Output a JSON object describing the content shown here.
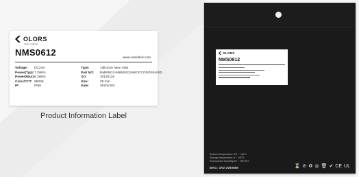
{
  "label": {
    "logo_text": "OLORS",
    "logo_tagline": "Colour Lighting",
    "model": "NMS0612",
    "website": "www.colorsled.com",
    "left_specs": [
      {
        "key": "Voltage:",
        "value": "DC24V"
      },
      {
        "key": "Power(Typ):",
        "value": "7.2W/m"
      },
      {
        "key": "Power(Max):",
        "value": "6.3W/m"
      },
      {
        "key": "Color/CCT:",
        "value": "6500K"
      },
      {
        "key": "IP:",
        "value": "IP65"
      }
    ],
    "right_specs": [
      {
        "key": "Type:",
        "value": "1@cicon neon strip"
      },
      {
        "key": "Part NO:",
        "value": "NMS0612-9NW24CSNSOCCOSOS0-ESD"
      },
      {
        "key": "SO:",
        "value": "20120116"
      },
      {
        "key": "Size:",
        "value": "25 mm"
      },
      {
        "key": "Date:",
        "value": "20201203"
      }
    ]
  },
  "caption": "Product Information Label",
  "bag": {
    "mini_logo_text": "OLORS",
    "mini_model": "NMS0612",
    "info_lines": [
      "Ambient temperature:-20 ~ +45°C",
      "Storage temperature:-0 ~ +60°C",
      "Environment humidity:45 ~ 75% RH"
    ],
    "code": "BAG: 3A2-2060MM",
    "icons": [
      "hourglass-icon",
      "no-symbol-icon",
      "recycle-icon",
      "circle-mark-icon",
      "waste-bin-icon",
      "checkmark-icon",
      "ce-mark-icon",
      "ul-mark-icon"
    ],
    "icon_glyphs": [
      "⌛",
      "⊘",
      "♻",
      "◎",
      "🗑",
      "✔",
      "CE",
      "UL"
    ]
  },
  "colors": {
    "background": "#f5f5f5",
    "bag": "#1a1a1a",
    "label": "#ffffff"
  }
}
